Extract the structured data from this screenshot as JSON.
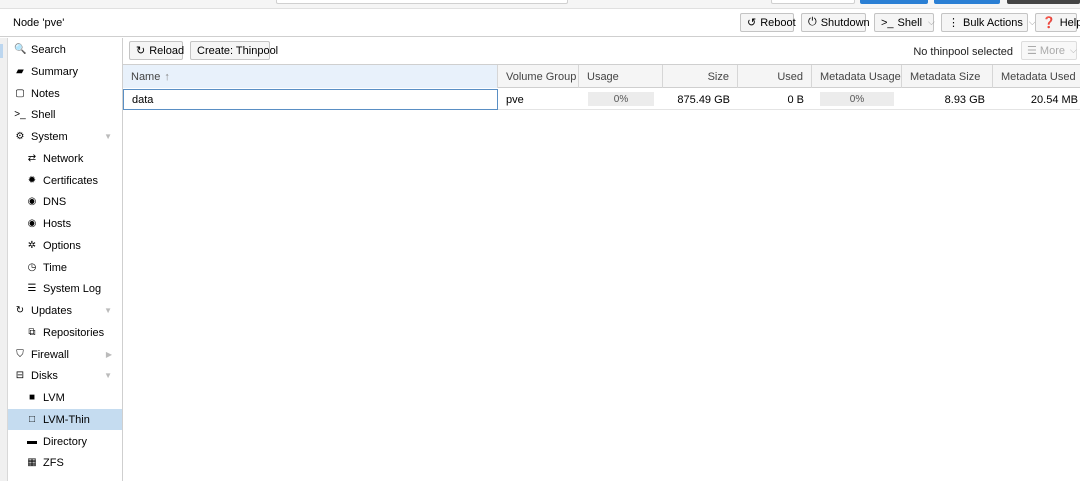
{
  "header": {
    "title": "Node 'pve'",
    "buttons": {
      "reboot": "Reboot",
      "shutdown": "Shutdown",
      "shell": "Shell",
      "bulk_actions": "Bulk Actions",
      "help": "Help"
    }
  },
  "sidebar": {
    "items": [
      {
        "label": "Search",
        "icon": "search-icon"
      },
      {
        "label": "Summary",
        "icon": "book-icon"
      },
      {
        "label": "Notes",
        "icon": "note-icon"
      },
      {
        "label": "Shell",
        "icon": "terminal-icon"
      },
      {
        "label": "System",
        "icon": "cogs-icon"
      },
      {
        "label": "Network",
        "icon": "exchange-icon"
      },
      {
        "label": "Certificates",
        "icon": "certificate-icon"
      },
      {
        "label": "DNS",
        "icon": "globe-icon"
      },
      {
        "label": "Hosts",
        "icon": "globe-icon"
      },
      {
        "label": "Options",
        "icon": "gear-icon"
      },
      {
        "label": "Time",
        "icon": "clock-icon"
      },
      {
        "label": "System Log",
        "icon": "list-icon"
      },
      {
        "label": "Updates",
        "icon": "refresh-icon"
      },
      {
        "label": "Repositories",
        "icon": "files-icon"
      },
      {
        "label": "Firewall",
        "icon": "shield-icon"
      },
      {
        "label": "Disks",
        "icon": "hdd-icon"
      },
      {
        "label": "LVM",
        "icon": "square-icon"
      },
      {
        "label": "LVM-Thin",
        "icon": "square-outline-icon"
      },
      {
        "label": "Directory",
        "icon": "folder-icon"
      },
      {
        "label": "ZFS",
        "icon": "th-large-icon"
      }
    ],
    "selected": "LVM-Thin"
  },
  "toolbar": {
    "reload": "Reload",
    "create": "Create: Thinpool",
    "status": "No thinpool selected",
    "more": "More"
  },
  "grid": {
    "columns": [
      "Name",
      "Volume Group",
      "Usage",
      "Size",
      "Used",
      "Metadata Usage",
      "Metadata Size",
      "Metadata Used"
    ],
    "rows": [
      {
        "name": "data",
        "volume_group": "pve",
        "usage": "0%",
        "size": "875.49 GB",
        "used": "0 B",
        "metadata_usage": "0%",
        "metadata_size": "8.93 GB",
        "metadata_used": "20.54 MB"
      }
    ]
  }
}
